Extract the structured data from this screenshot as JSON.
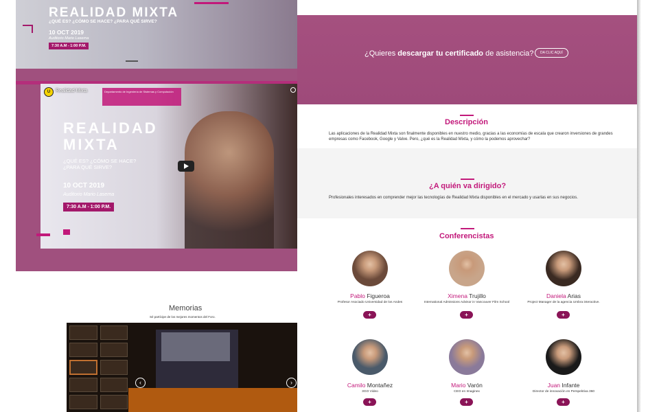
{
  "hero": {
    "title": "REALIDAD MIXTA",
    "subtitle": "¿QUÉ ES? ¿CÓMO SE HACE? ¿PARA QUÉ SIRVE?",
    "date": "10 OCT 2019",
    "place": "Auditorio Mario Laserna",
    "time": "7:30 A.M - 1:00 P.M."
  },
  "video": {
    "channel": "Realidad Mixta",
    "title_line1": "REALIDAD",
    "title_line2": "MIXTA",
    "question1": "¿QUÉ ES? ¿CÓMO SE HACE?",
    "question2": "¿PARA QUÉ SIRVE?",
    "date": "10 OCT 2019",
    "place": "Auditorio Mario Laserna",
    "time": "7:30 A.M - 1:00 P.M.",
    "org": "Departamento de Ingeniería de Sistemas y Computación"
  },
  "memorias": {
    "title": "Memorias",
    "subtitle": "Sé partícipe de los mejores momentos del Foro."
  },
  "certificate": {
    "prefix": "¿Quieres ",
    "bold": "descargar tu certificado",
    "suffix": " de asistencia?",
    "button": "DA CLIC AQUÍ"
  },
  "descripcion": {
    "title": "Descripción",
    "body": "Las aplicaciones de la Realidad Mixta son finalmente disponibles en nuestro medio, gracias a las economías de escala que crearon inversiones de grandes empresas como Facebook, Google y Valve. Pero, ¿qué es la Realidad Mixta, y cómo la podemos aprovechar?"
  },
  "audience": {
    "title": "¿A quién va dirigido?",
    "body": "Profesionales interesados en comprender mejor las tecnologías de Realidad Mixta disponibles en el mercado y usarlas en sus negocios."
  },
  "speakers": {
    "title": "Conferencistas",
    "plus_label": "+",
    "list": [
      {
        "first": "Pablo",
        "last": " Figueroa",
        "role": "Profesor Asociado Universidad de los Andes",
        "bg": "#6b4a3a"
      },
      {
        "first": "Ximena",
        "last": " Trujillo",
        "role": "International Admissions Advisor in Vancouver Film School",
        "bg": "#c8a58a"
      },
      {
        "first": "Daniela",
        "last": " Arias",
        "role": "Project Manager de la agencia Umbra interactive.",
        "bg": "#3a2a22"
      },
      {
        "first": "Camilo",
        "last": " Montañez",
        "role": "3GO Video",
        "bg": "#4a5a6a"
      },
      {
        "first": "Mario",
        "last": " Varón",
        "role": "CEO en Imaginex",
        "bg": "#8a7a9a"
      },
      {
        "first": "Juan",
        "last": " Infante",
        "role": "Director de innovación en Perspektiva 360",
        "bg": "#1a1a1a"
      }
    ]
  },
  "colors": {
    "accent": "#c2187a",
    "banner": "#a5507f",
    "button": "#8a1457"
  }
}
